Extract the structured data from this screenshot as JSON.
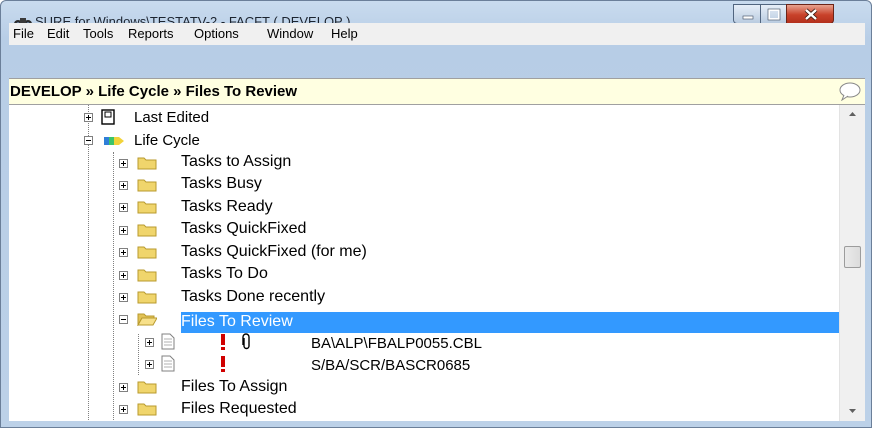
{
  "window": {
    "title": "SURE for Windows\\TESTATV-2 - FACFT ( DEVELOP )"
  },
  "menu": [
    "File",
    "Edit",
    "Tools",
    "Reports",
    "Options",
    "Window",
    "Help"
  ],
  "breadcrumb": "DEVELOP » Life Cycle » Files To Review",
  "tree": {
    "last_edited": "Last Edited",
    "life_cycle": "Life Cycle",
    "folders": [
      "Tasks to Assign",
      "Tasks Busy",
      "Tasks Ready",
      "Tasks QuickFixed",
      "Tasks QuickFixed (for me)",
      "Tasks To Do",
      "Tasks Done recently"
    ],
    "selected": "Files To Review",
    "files": [
      "BA\\ALP\\FBALP0055.CBL",
      "S/BA/SCR/BASCR0685"
    ],
    "after": [
      "Files To Assign",
      "Files Requested"
    ]
  },
  "colors": {
    "selection": "#3399ff",
    "breadcrumb_bg": "#ffffe1",
    "folder": "#f0d56c",
    "alert": "#d00000"
  }
}
